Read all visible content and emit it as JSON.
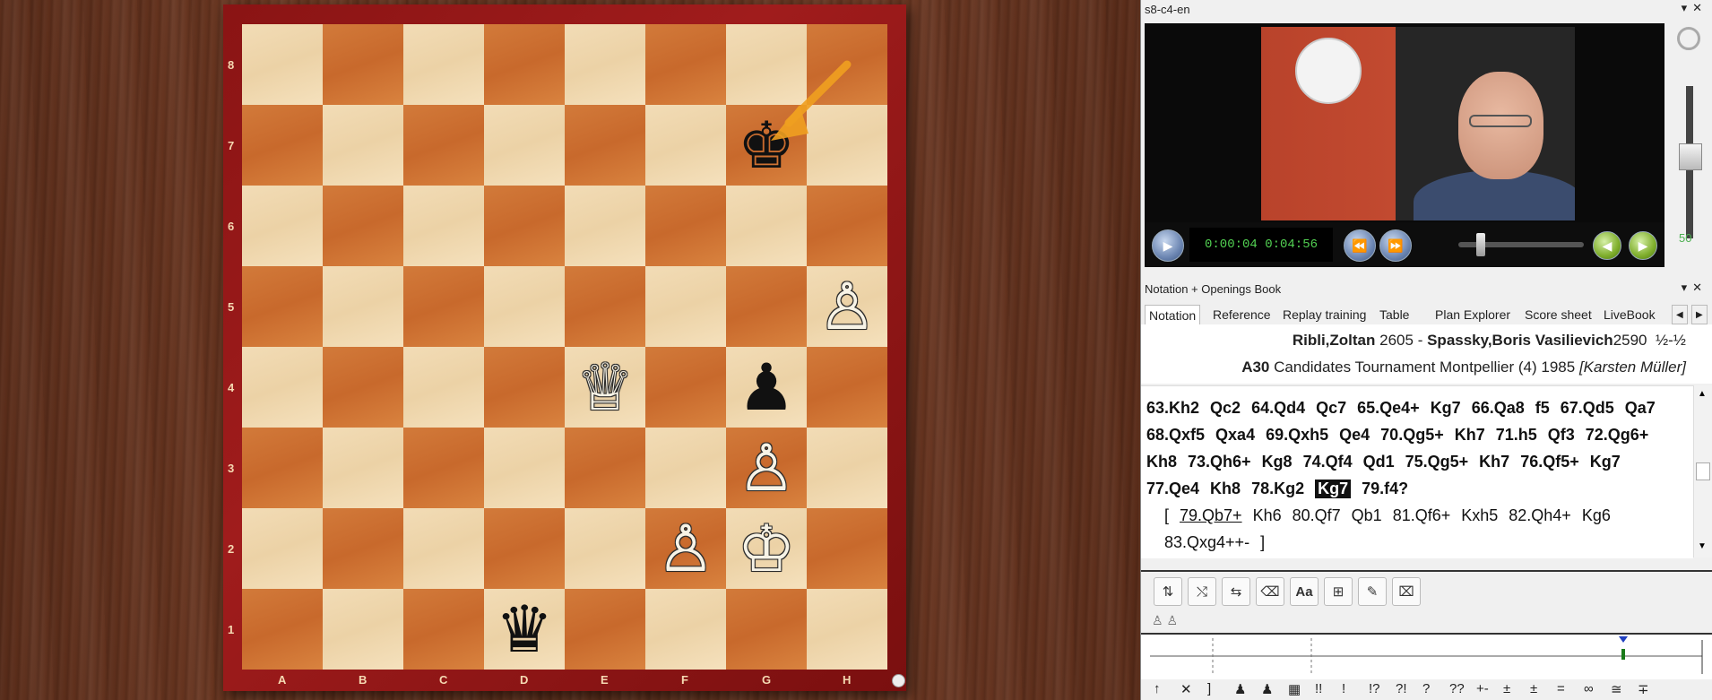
{
  "board": {
    "files": [
      "A",
      "B",
      "C",
      "D",
      "E",
      "F",
      "G",
      "H"
    ],
    "ranks": [
      "8",
      "7",
      "6",
      "5",
      "4",
      "3",
      "2",
      "1"
    ],
    "pieces": [
      {
        "square": "g7",
        "piece": "k",
        "color": "black",
        "glyph": "♚"
      },
      {
        "square": "h5",
        "piece": "p",
        "color": "white",
        "glyph": "♙"
      },
      {
        "square": "e4",
        "piece": "q",
        "color": "white",
        "glyph": "♕"
      },
      {
        "square": "g4",
        "piece": "p",
        "color": "black",
        "glyph": "♟"
      },
      {
        "square": "g3",
        "piece": "p",
        "color": "white",
        "glyph": "♙"
      },
      {
        "square": "f2",
        "piece": "p",
        "color": "white",
        "glyph": "♙"
      },
      {
        "square": "g2",
        "piece": "k",
        "color": "white",
        "glyph": "♔"
      },
      {
        "square": "d1",
        "piece": "q",
        "color": "black",
        "glyph": "♛"
      }
    ],
    "arrow_color": "#f0a020"
  },
  "video_pane": {
    "title": "s8-c4-en",
    "time": "0:00:04  0:04:56",
    "volume": "50"
  },
  "notation_pane": {
    "title": "Notation + Openings Book",
    "tabs": [
      "Notation",
      "Reference",
      "Replay training",
      "Table",
      "Plan Explorer",
      "Score sheet",
      "LiveBook"
    ]
  },
  "game": {
    "white": "Ribli,Zoltan",
    "white_elo": "2605",
    "separator": "-",
    "black": "Spassky,Boris Vasilievich",
    "black_elo": "2590",
    "result": "½-½",
    "eco": "A30",
    "event": "Candidates Tournament Montpellier (4) 1985",
    "annotator": "[Karsten Müller]"
  },
  "moves": {
    "line1": [
      "63.Kh2",
      "Qc2",
      "64.Qd4",
      "Qc7",
      "65.Qe4+",
      "Kg7",
      "66.Qa8",
      "f5",
      "67.Qd5",
      "Qa7"
    ],
    "line2": [
      "68.Qxf5",
      "Qxa4",
      "69.Qxh5",
      "Qe4",
      "70.Qg5+",
      "Kh7",
      "71.h5",
      "Qf3",
      "72.Qg6+"
    ],
    "line3": [
      "Kh8",
      "73.Qh6+",
      "Kg8",
      "74.Qf4",
      "Qd1",
      "75.Qg5+",
      "Kh7",
      "76.Qf5+",
      "Kg7"
    ],
    "line4": [
      "77.Qe4",
      "Kh8",
      "78.Kg2",
      "Kg7",
      "79.f4?"
    ],
    "current_move": "Kg7",
    "variation1": [
      "[",
      "79.Qb7+",
      "Kh6",
      "80.Qf7",
      "Qb1",
      "81.Qf6+",
      "Kxh5",
      "82.Qh4+",
      "Kg6"
    ],
    "variation2": [
      "83.Qxg4++-",
      "]"
    ]
  },
  "symbols": [
    "↑",
    "✕",
    "]",
    "♟",
    "♟",
    "▦",
    "!!",
    "!",
    "!?",
    "?!",
    "?",
    "??",
    "+-",
    "±",
    "±",
    "=",
    "∞",
    "≅",
    "∓"
  ]
}
